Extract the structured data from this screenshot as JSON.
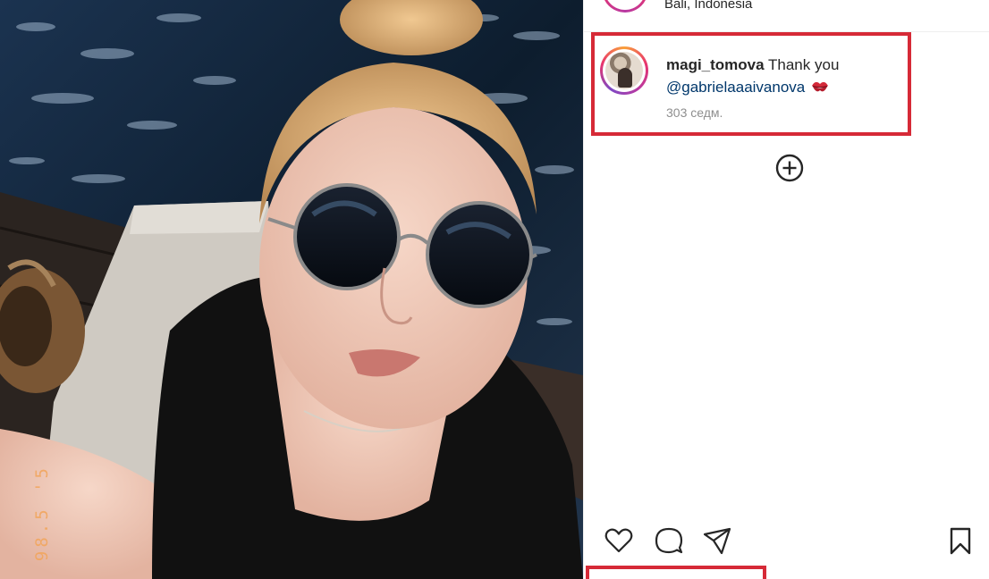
{
  "post": {
    "location": "Bali, Indonesia",
    "photo_stamp": "98.5 '5"
  },
  "comment": {
    "username": "magi_tomova",
    "text": "Thank you",
    "mention": "@gabrielaaaivanova",
    "emoji": "kiss-mark",
    "time": "303 седм."
  },
  "icons": {
    "add": "plus-circle-icon",
    "like": "heart-icon",
    "comment": "comment-bubble-icon",
    "share": "paper-plane-icon",
    "save": "bookmark-icon"
  },
  "colors": {
    "highlight": "#d62a37",
    "mention": "#00376b",
    "muted": "#8e8e8e"
  }
}
